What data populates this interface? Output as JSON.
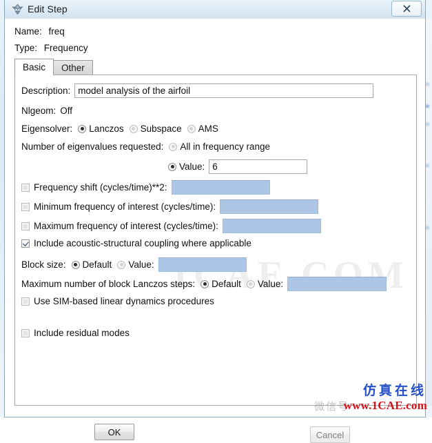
{
  "window": {
    "title": "Edit Step",
    "icon": "abaqus-diamond-icon",
    "close_label": "✕"
  },
  "header": {
    "name_label": "Name:",
    "name_value": "freq",
    "type_label": "Type:",
    "type_value": "Frequency"
  },
  "tabs": [
    {
      "label": "Basic",
      "active": true
    },
    {
      "label": "Other",
      "active": false
    }
  ],
  "basic": {
    "description_label": "Description:",
    "description_value": "model analysis of the airfoil",
    "nlgeom_label": "Nlgeom:",
    "nlgeom_value": "Off",
    "eigensolver_label": "Eigensolver:",
    "eigensolver_options": [
      {
        "label": "Lanczos",
        "selected": true
      },
      {
        "label": "Subspace",
        "selected": false
      },
      {
        "label": "AMS",
        "selected": false
      }
    ],
    "num_eigen_label": "Number of eigenvalues requested:",
    "num_eigen_all_label": "All in frequency range",
    "num_eigen_all_selected": false,
    "num_eigen_value_label": "Value:",
    "num_eigen_value_selected": true,
    "num_eigen_value": "6",
    "freq_shift_label": "Frequency shift (cycles/time)**2:",
    "freq_shift_checked": false,
    "freq_shift_value": "",
    "min_freq_label": "Minimum frequency of interest (cycles/time):",
    "min_freq_checked": false,
    "min_freq_value": "",
    "max_freq_label": "Maximum frequency of interest (cycles/time):",
    "max_freq_checked": false,
    "max_freq_value": "",
    "acoustic_label": "Include acoustic-structural coupling where applicable",
    "acoustic_checked": true,
    "block_size_label": "Block size:",
    "block_size_default_label": "Default",
    "block_size_default_selected": true,
    "block_size_value_label": "Value:",
    "block_size_value_selected": false,
    "block_size_value": "",
    "max_steps_label": "Maximum number of block Lanczos steps:",
    "max_steps_default_label": "Default",
    "max_steps_default_selected": true,
    "max_steps_value_label": "Value:",
    "max_steps_value_selected": false,
    "max_steps_value": "",
    "sim_label": "Use SIM-based linear dynamics procedures",
    "sim_checked": false,
    "residual_label": "Include residual modes",
    "residual_checked": false
  },
  "buttons": {
    "ok": "OK",
    "cancel": "Cancel"
  },
  "watermark": {
    "cn_text": "仿真在线",
    "url_text": "www.1CAE.com",
    "weixin_text": "微信号",
    "center_text": "1CAE.COM"
  },
  "colors": {
    "disabled_field": "#adc6e5",
    "watermark_blue": "#2650c8",
    "watermark_red": "#d81217",
    "title_bar": "#dceaf5"
  }
}
